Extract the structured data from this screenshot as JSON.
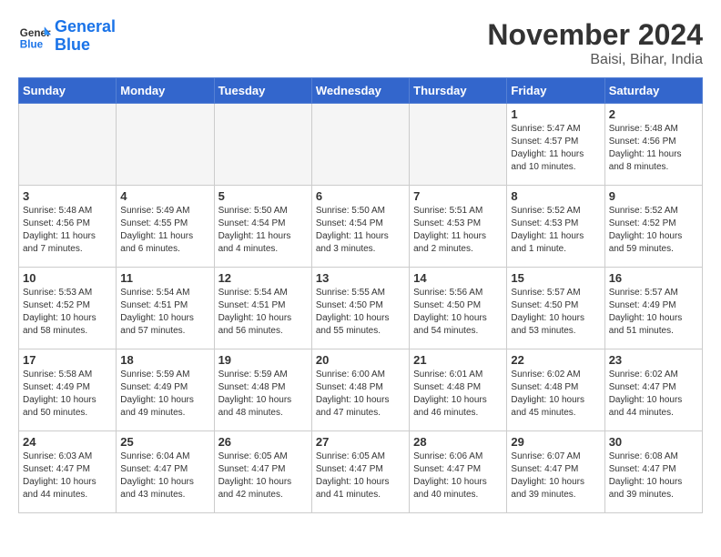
{
  "logo": {
    "line1": "General",
    "line2": "Blue"
  },
  "title": "November 2024",
  "location": "Baisi, Bihar, India",
  "weekdays": [
    "Sunday",
    "Monday",
    "Tuesday",
    "Wednesday",
    "Thursday",
    "Friday",
    "Saturday"
  ],
  "weeks": [
    [
      {
        "day": "",
        "info": ""
      },
      {
        "day": "",
        "info": ""
      },
      {
        "day": "",
        "info": ""
      },
      {
        "day": "",
        "info": ""
      },
      {
        "day": "",
        "info": ""
      },
      {
        "day": "1",
        "info": "Sunrise: 5:47 AM\nSunset: 4:57 PM\nDaylight: 11 hours\nand 10 minutes."
      },
      {
        "day": "2",
        "info": "Sunrise: 5:48 AM\nSunset: 4:56 PM\nDaylight: 11 hours\nand 8 minutes."
      }
    ],
    [
      {
        "day": "3",
        "info": "Sunrise: 5:48 AM\nSunset: 4:56 PM\nDaylight: 11 hours\nand 7 minutes."
      },
      {
        "day": "4",
        "info": "Sunrise: 5:49 AM\nSunset: 4:55 PM\nDaylight: 11 hours\nand 6 minutes."
      },
      {
        "day": "5",
        "info": "Sunrise: 5:50 AM\nSunset: 4:54 PM\nDaylight: 11 hours\nand 4 minutes."
      },
      {
        "day": "6",
        "info": "Sunrise: 5:50 AM\nSunset: 4:54 PM\nDaylight: 11 hours\nand 3 minutes."
      },
      {
        "day": "7",
        "info": "Sunrise: 5:51 AM\nSunset: 4:53 PM\nDaylight: 11 hours\nand 2 minutes."
      },
      {
        "day": "8",
        "info": "Sunrise: 5:52 AM\nSunset: 4:53 PM\nDaylight: 11 hours\nand 1 minute."
      },
      {
        "day": "9",
        "info": "Sunrise: 5:52 AM\nSunset: 4:52 PM\nDaylight: 10 hours\nand 59 minutes."
      }
    ],
    [
      {
        "day": "10",
        "info": "Sunrise: 5:53 AM\nSunset: 4:52 PM\nDaylight: 10 hours\nand 58 minutes."
      },
      {
        "day": "11",
        "info": "Sunrise: 5:54 AM\nSunset: 4:51 PM\nDaylight: 10 hours\nand 57 minutes."
      },
      {
        "day": "12",
        "info": "Sunrise: 5:54 AM\nSunset: 4:51 PM\nDaylight: 10 hours\nand 56 minutes."
      },
      {
        "day": "13",
        "info": "Sunrise: 5:55 AM\nSunset: 4:50 PM\nDaylight: 10 hours\nand 55 minutes."
      },
      {
        "day": "14",
        "info": "Sunrise: 5:56 AM\nSunset: 4:50 PM\nDaylight: 10 hours\nand 54 minutes."
      },
      {
        "day": "15",
        "info": "Sunrise: 5:57 AM\nSunset: 4:50 PM\nDaylight: 10 hours\nand 53 minutes."
      },
      {
        "day": "16",
        "info": "Sunrise: 5:57 AM\nSunset: 4:49 PM\nDaylight: 10 hours\nand 51 minutes."
      }
    ],
    [
      {
        "day": "17",
        "info": "Sunrise: 5:58 AM\nSunset: 4:49 PM\nDaylight: 10 hours\nand 50 minutes."
      },
      {
        "day": "18",
        "info": "Sunrise: 5:59 AM\nSunset: 4:49 PM\nDaylight: 10 hours\nand 49 minutes."
      },
      {
        "day": "19",
        "info": "Sunrise: 5:59 AM\nSunset: 4:48 PM\nDaylight: 10 hours\nand 48 minutes."
      },
      {
        "day": "20",
        "info": "Sunrise: 6:00 AM\nSunset: 4:48 PM\nDaylight: 10 hours\nand 47 minutes."
      },
      {
        "day": "21",
        "info": "Sunrise: 6:01 AM\nSunset: 4:48 PM\nDaylight: 10 hours\nand 46 minutes."
      },
      {
        "day": "22",
        "info": "Sunrise: 6:02 AM\nSunset: 4:48 PM\nDaylight: 10 hours\nand 45 minutes."
      },
      {
        "day": "23",
        "info": "Sunrise: 6:02 AM\nSunset: 4:47 PM\nDaylight: 10 hours\nand 44 minutes."
      }
    ],
    [
      {
        "day": "24",
        "info": "Sunrise: 6:03 AM\nSunset: 4:47 PM\nDaylight: 10 hours\nand 44 minutes."
      },
      {
        "day": "25",
        "info": "Sunrise: 6:04 AM\nSunset: 4:47 PM\nDaylight: 10 hours\nand 43 minutes."
      },
      {
        "day": "26",
        "info": "Sunrise: 6:05 AM\nSunset: 4:47 PM\nDaylight: 10 hours\nand 42 minutes."
      },
      {
        "day": "27",
        "info": "Sunrise: 6:05 AM\nSunset: 4:47 PM\nDaylight: 10 hours\nand 41 minutes."
      },
      {
        "day": "28",
        "info": "Sunrise: 6:06 AM\nSunset: 4:47 PM\nDaylight: 10 hours\nand 40 minutes."
      },
      {
        "day": "29",
        "info": "Sunrise: 6:07 AM\nSunset: 4:47 PM\nDaylight: 10 hours\nand 39 minutes."
      },
      {
        "day": "30",
        "info": "Sunrise: 6:08 AM\nSunset: 4:47 PM\nDaylight: 10 hours\nand 39 minutes."
      }
    ]
  ]
}
